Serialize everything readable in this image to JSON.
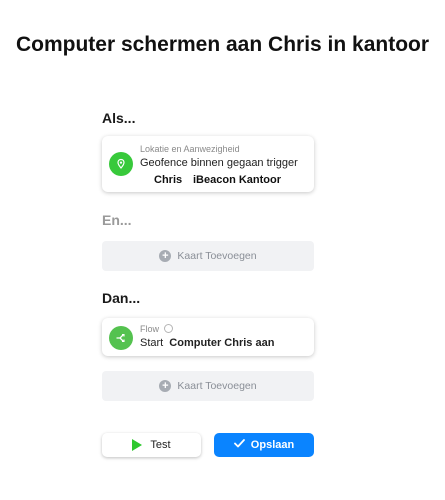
{
  "title": "Computer schermen aan Chris in kantoor",
  "sections": {
    "if_label": "Als...",
    "and_label": "En...",
    "then_label": "Dan..."
  },
  "trigger_card": {
    "category": "Lokatie en Aanwezigheid",
    "title": "Geofence binnen gegaan trigger",
    "arg_user": "Chris",
    "arg_beacon": "iBeacon Kantoor",
    "icon": "location-pin-icon",
    "icon_color": "#38c93b"
  },
  "action_card": {
    "category": "Flow",
    "verb": "Start",
    "target": "Computer Chris aan",
    "icon": "flow-icon",
    "icon_color": "#54c24f"
  },
  "add_card_label": "Kaart Toevoegen",
  "buttons": {
    "test": "Test",
    "save": "Opslaan"
  },
  "colors": {
    "accent": "#0a84ff",
    "green": "#38c93b"
  }
}
